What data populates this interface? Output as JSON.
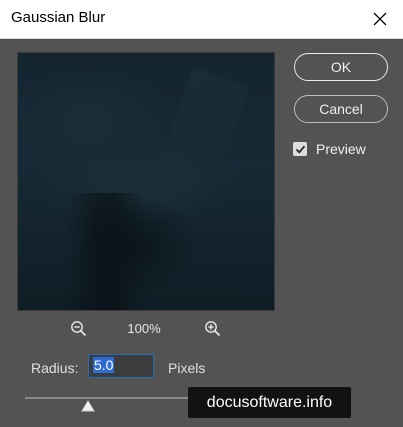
{
  "dialog": {
    "title": "Gaussian Blur",
    "close_icon": "close-icon"
  },
  "buttons": {
    "ok_label": "OK",
    "cancel_label": "Cancel"
  },
  "preview_option": {
    "label": "Preview",
    "checked": true
  },
  "zoom": {
    "zoom_out_icon": "zoom-out-icon",
    "level": "100%",
    "zoom_in_icon": "zoom-in-icon"
  },
  "radius": {
    "label": "Radius:",
    "value": "5.0",
    "unit": "Pixels"
  },
  "watermark": {
    "text": "docusoftware.info"
  },
  "colors": {
    "dialog_background": "#535353",
    "selection_highlight": "#2e6bd2",
    "preview_dark": "#142530"
  }
}
